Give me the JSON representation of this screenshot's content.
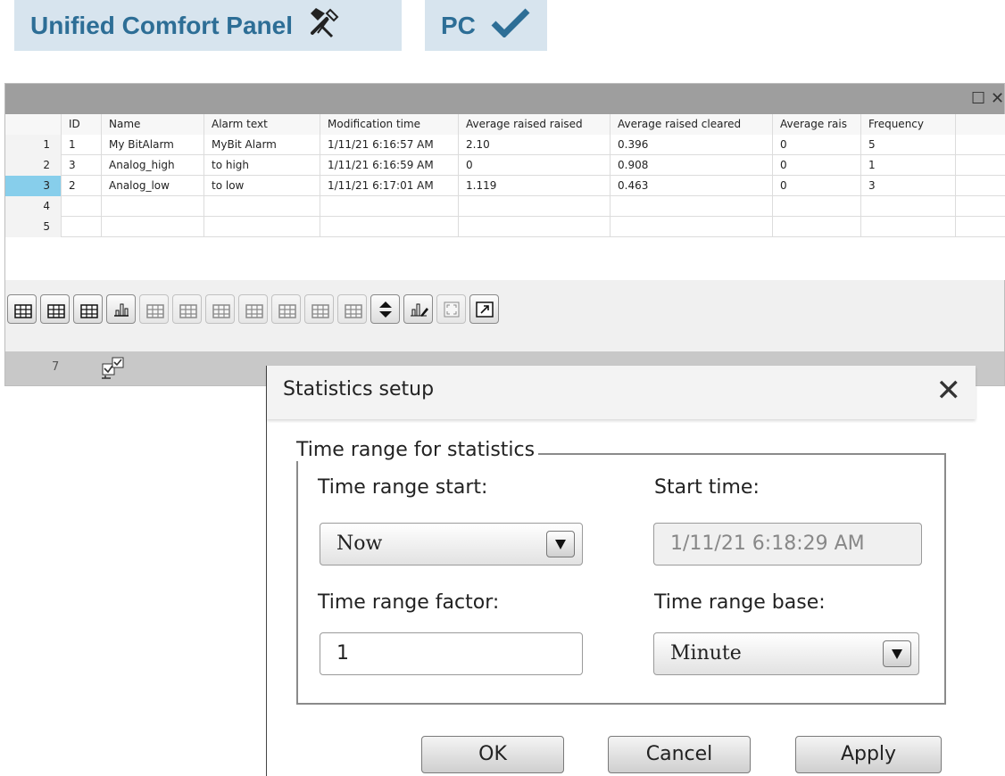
{
  "header": {
    "device_label": "Unified Comfort Panel",
    "device_icon": "tools-icon",
    "target_label": "PC",
    "target_icon": "checkmark-icon"
  },
  "table": {
    "columns": [
      "ID",
      "Name",
      "Alarm text",
      "Modification time",
      "Average raised raised",
      "Average raised cleared",
      "Average rais",
      "Frequency"
    ],
    "rows": [
      {
        "num": "1",
        "cells": [
          "1",
          "My BitAlarm",
          "MyBit Alarm",
          "1/11/21 6:16:57 AM",
          "2.10",
          "0.396",
          "0",
          "5"
        ]
      },
      {
        "num": "2",
        "cells": [
          "3",
          "Analog_high",
          "to high",
          "1/11/21 6:16:59 AM",
          "0",
          "0.908",
          "0",
          "1"
        ]
      },
      {
        "num": "3",
        "cells": [
          "2",
          "Analog_low",
          "to low",
          "1/11/21 6:17:01 AM",
          "1.119",
          "0.463",
          "0",
          "3"
        ]
      },
      {
        "num": "4",
        "cells": [
          "",
          "",
          "",
          "",
          "",
          "",
          "",
          ""
        ]
      },
      {
        "num": "5",
        "cells": [
          "",
          "",
          "",
          "",
          "",
          "",
          "",
          ""
        ]
      }
    ],
    "selected_row": "3",
    "status_number": "7"
  },
  "toolbar": {
    "buttons": [
      "refresh-table-icon",
      "table-db-icon",
      "table-export-icon",
      "statistics-chart-icon",
      "table-up-icon",
      "table-first-icon",
      "table-down-icon",
      "table-last-icon",
      "table-check-icon",
      "table-edit-check-icon",
      "table-refresh-icon",
      "sort-icon",
      "chart-edit-icon",
      "fullscreen-icon",
      "export-icon"
    ]
  },
  "dialog": {
    "title": "Statistics setup",
    "group_title": "Time range for statistics",
    "time_range_start_label": "Time range start:",
    "time_range_start_value": "Now",
    "start_time_label": "Start time:",
    "start_time_value": "1/11/21 6:18:29 AM",
    "time_range_factor_label": "Time range factor:",
    "time_range_factor_value": "1",
    "time_range_base_label": "Time range base:",
    "time_range_base_value": "Minute",
    "ok_label": "OK",
    "cancel_label": "Cancel",
    "apply_label": "Apply"
  },
  "colors": {
    "badge_bg": "#d7e4ee",
    "badge_text": "#2d6e96",
    "selected_row": "#87ceeb"
  }
}
